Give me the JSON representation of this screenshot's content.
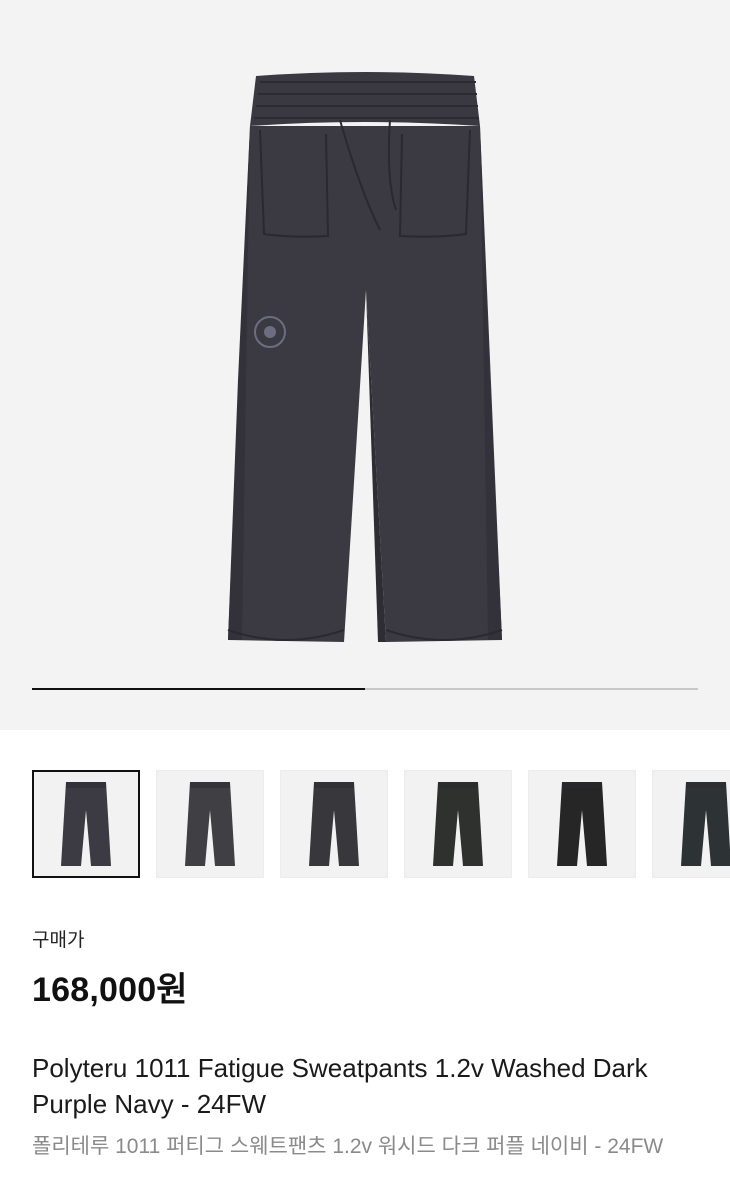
{
  "gallery": {
    "main_image": "pants-photo",
    "progress": 0.5,
    "thumbnails": [
      {
        "name": "thumb-1",
        "color": "#3c3b44",
        "selected": true
      },
      {
        "name": "thumb-2",
        "color": "#3f3f44",
        "selected": false
      },
      {
        "name": "thumb-3",
        "color": "#38383c",
        "selected": false
      },
      {
        "name": "thumb-4",
        "color": "#2f312f",
        "selected": false
      },
      {
        "name": "thumb-5",
        "color": "#262626",
        "selected": false
      },
      {
        "name": "thumb-6",
        "color": "#2d3234",
        "selected": false
      }
    ]
  },
  "product": {
    "price_label": "구매가",
    "price": "168,000원",
    "title_en": "Polyteru 1011 Fatigue Sweatpants 1.2v Washed Dark Purple Navy - 24FW",
    "title_ko": "폴리테루 1011 퍼티그 스웨트팬츠 1.2v 워시드 다크 퍼플 네이비 - 24FW"
  },
  "colors": {
    "garment": "#3b3a42",
    "background": "#f3f3f3",
    "accent": "#111111",
    "muted": "#8a8a8a"
  }
}
